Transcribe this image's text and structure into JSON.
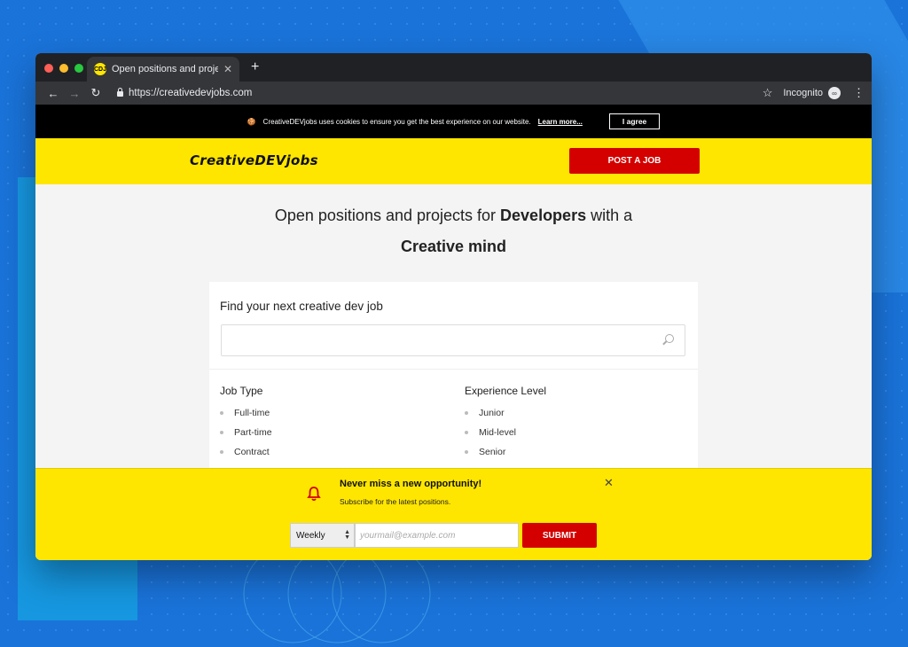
{
  "browser": {
    "tab_title": "Open positions and projects fo",
    "tab_favicon": "CDJ",
    "url": "https://creativedevjobs.com",
    "incognito_label": "Incognito"
  },
  "cookie_banner": {
    "text": "CreativeDEVjobs uses cookies to ensure you get the best experience on our website.",
    "learn_more": "Learn more...",
    "agree_label": "I agree"
  },
  "header": {
    "logo": "CreativeDEVjobs",
    "post_job_label": "POST A JOB"
  },
  "hero": {
    "part1": "Open positions and projects for ",
    "bold1": "Developers",
    "part2": " with a",
    "bold2": "Creative mind"
  },
  "search": {
    "title": "Find your next creative dev job",
    "placeholder": ""
  },
  "filters": {
    "job_type": {
      "heading": "Job Type",
      "items": [
        "Full-time",
        "Part-time",
        "Contract"
      ]
    },
    "experience": {
      "heading": "Experience Level",
      "items": [
        "Junior",
        "Mid-level",
        "Senior"
      ]
    }
  },
  "newsletter": {
    "title": "Never miss a new opportunity!",
    "subtitle": "Subscribe for the latest positions.",
    "frequency": "Weekly",
    "email_placeholder": "yourmail@example.com",
    "submit_label": "SUBMIT"
  },
  "colors": {
    "brand_yellow": "#ffe600",
    "brand_red": "#d40000",
    "background_blue": "#1a73d9"
  }
}
